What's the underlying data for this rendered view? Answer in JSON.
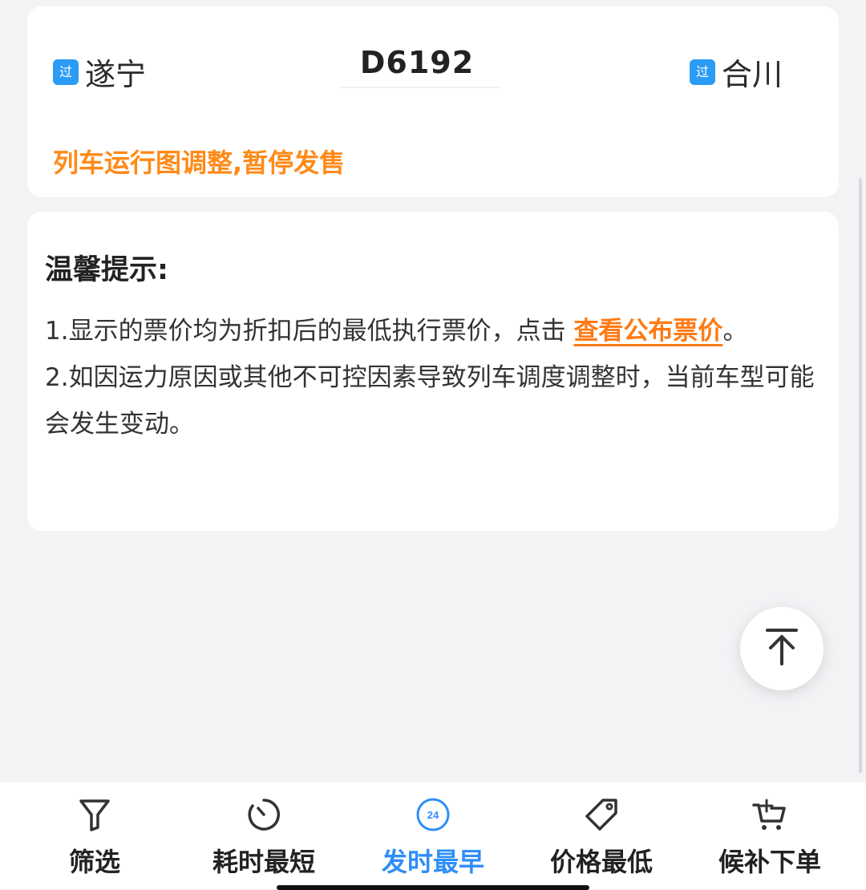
{
  "train": {
    "from_badge": "过",
    "from_station": "遂宁",
    "number": "D6192",
    "to_badge": "过",
    "to_station": "合川",
    "notice": "列车运行图调整,暂停发售"
  },
  "tips": {
    "title": "温馨提示:",
    "item1_text": "1.显示的票价均为折扣后的最低执行票价，点击 ",
    "item1_link": "查看公布票价",
    "item1_end": "。",
    "item2_text": "2.如因运力原因或其他不可控因素导致列车调度调整时，当前车型可能会发生变动。"
  },
  "back_to_top": {
    "icon": "arrow-up-icon"
  },
  "bottom_bar": {
    "items": [
      {
        "label": "筛选",
        "icon": "filter-icon",
        "active": false
      },
      {
        "label": "耗时最短",
        "icon": "timer-icon",
        "active": false
      },
      {
        "label": "发时最早",
        "icon": "clock-24-icon",
        "icon_text": "24",
        "active": true
      },
      {
        "label": "价格最低",
        "icon": "price-tag-icon",
        "active": false
      },
      {
        "label": "候补下单",
        "icon": "cart-plus-icon",
        "active": false
      }
    ]
  },
  "colors": {
    "accent_blue": "#2f8ef7",
    "notice_orange": "#ff8a18",
    "badge_blue": "#2b9bf5",
    "background": "#f3f3f6"
  }
}
